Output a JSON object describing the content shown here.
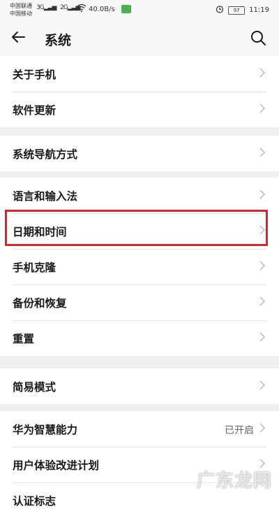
{
  "status_bar": {
    "carrier1": "中国联通",
    "carrier2": "中国移动",
    "net1": "3G",
    "net2": "2G",
    "speed": "40.0B/s",
    "battery": "97",
    "time": "11:19"
  },
  "header": {
    "title": "系统"
  },
  "groups": [
    {
      "items": [
        {
          "label": "关于手机"
        },
        {
          "label": "软件更新"
        }
      ]
    },
    {
      "items": [
        {
          "label": "系统导航方式"
        }
      ]
    },
    {
      "items": [
        {
          "label": "语言和输入法"
        },
        {
          "label": "日期和时间"
        },
        {
          "label": "手机克隆"
        },
        {
          "label": "备份和恢复"
        },
        {
          "label": "重置"
        }
      ]
    },
    {
      "items": [
        {
          "label": "简易模式"
        }
      ]
    },
    {
      "items": [
        {
          "label": "华为智慧能力",
          "value": "已开启"
        },
        {
          "label": "用户体验改进计划"
        },
        {
          "label": "认证标志"
        }
      ]
    }
  ],
  "highlighted_item": "日期和时间",
  "watermark": "广东龙网"
}
